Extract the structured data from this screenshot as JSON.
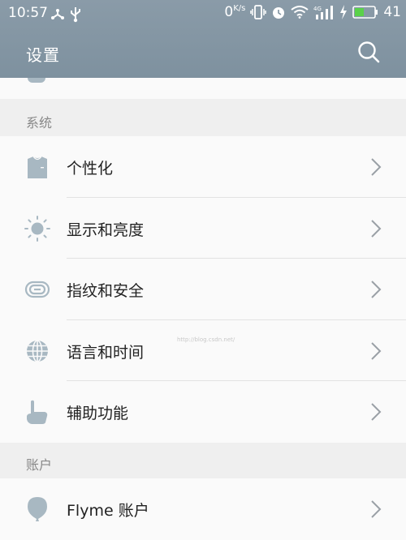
{
  "status_bar": {
    "time": "10:57",
    "net_speed_value": "0",
    "net_speed_unit": "K/s",
    "network_type": "4G",
    "battery_percent": "41"
  },
  "header": {
    "title": "设置",
    "search_icon": "search-icon"
  },
  "sections": [
    {
      "title": "系统",
      "items": [
        {
          "label": "个性化",
          "icon": "shirt-icon"
        },
        {
          "label": "显示和亮度",
          "icon": "sun-icon"
        },
        {
          "label": "指纹和安全",
          "icon": "fingerprint-icon"
        },
        {
          "label": "语言和时间",
          "icon": "globe-icon"
        },
        {
          "label": "辅助功能",
          "icon": "hand-pointer-icon"
        }
      ]
    },
    {
      "title": "账户",
      "items": [
        {
          "label": "Flyme 账户",
          "icon": "balloon-icon"
        }
      ]
    }
  ],
  "watermark": "http://blog.csdn.net/",
  "colors": {
    "header_bg": "#7e919f",
    "icon": "#a8b8c2",
    "chevron": "#9aa0a6"
  }
}
